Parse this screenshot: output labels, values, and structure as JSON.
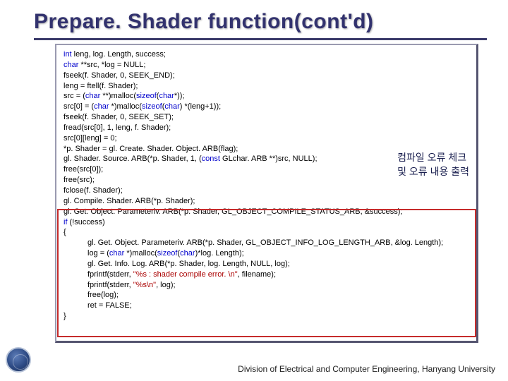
{
  "title": "Prepare. Shader function(cont'd)",
  "annotation": {
    "line1": "컴파일 오류 체크",
    "line2": "및 오류 내용 출력"
  },
  "footer": "Division of Electrical and Computer Engineering, Hanyang University",
  "code": {
    "l1a": "int",
    "l1b": " leng, log. Length, success;",
    "l2a": "char",
    "l2b": " **src, *log = NULL;",
    "l3": "fseek(f. Shader, 0, SEEK_END);",
    "l4": "leng = ftell(f. Shader);",
    "l5a": "src = (",
    "l5b": "char",
    "l5c": " **)malloc(",
    "l5d": "sizeof",
    "l5e": "(",
    "l5f": "char",
    "l5g": "*));",
    "l6a": "src[0] = (",
    "l6b": "char",
    "l6c": " *)malloc(",
    "l6d": "sizeof",
    "l6e": "(",
    "l6f": "char",
    "l6g": ") *(leng+1));",
    "l7": "fseek(f. Shader, 0, SEEK_SET);",
    "l8": "fread(src[0], 1, leng, f. Shader);",
    "l9": "src[0][leng] = 0;",
    "l10": "*p. Shader = gl. Create. Shader. Object. ARB(flag);",
    "l11a": "gl. Shader. Source. ARB(*p. Shader, 1, (",
    "l11b": "const",
    "l11c": " GLchar. ARB **)src, NULL);",
    "l12": "free(src[0]);",
    "l13": "free(src);",
    "l14": "fclose(f. Shader);",
    "l15": "gl. Compile. Shader. ARB(*p. Shader);",
    "l16": "gl. Get. Object. Parameteriv. ARB(*p. Shader, GL_OBJECT_COMPILE_STATUS_ARB, &success);",
    "l17a": "if",
    "l17b": " (!success)",
    "l18": "{",
    "l19": "gl. Get. Object. Parameteriv. ARB(*p. Shader, GL_OBJECT_INFO_LOG_LENGTH_ARB, &log. Length);",
    "l20a": "log = (",
    "l20b": "char",
    "l20c": " *)malloc(",
    "l20d": "sizeof",
    "l20e": "(",
    "l20f": "char",
    "l20g": ")*log. Length);",
    "l21": "gl. Get. Info. Log. ARB(*p. Shader, log. Length, NULL, log);",
    "l22a": "fprintf(stderr, ",
    "l22b": "\"%s : shader compile error. \\n\"",
    "l22c": ", filename);",
    "l23a": "fprintf(stderr, ",
    "l23b": "\"%s\\n\"",
    "l23c": ", log);",
    "l24": "free(log);",
    "l25": "ret = FALSE;",
    "l26": "}"
  }
}
